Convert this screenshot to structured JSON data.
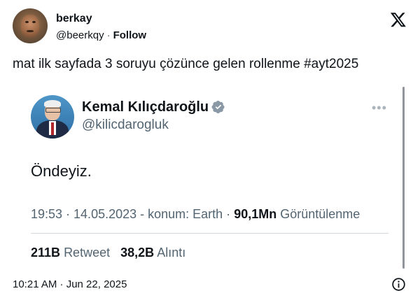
{
  "author": {
    "name": "berkay",
    "handle": "@beerkqy",
    "separator": "·",
    "follow_label": "Follow"
  },
  "brand_icon": "x-logo-icon",
  "tweet": {
    "text": "mat ilk sayfada 3 soruyu çözünce gelen rollenme #ayt2025",
    "timestamp": "10:21 AM · Jun 22, 2025",
    "info_icon": "info-icon"
  },
  "embedded_tweet": {
    "name": "Kemal Kılıçdaroğlu",
    "handle": "@kilicdarogluk",
    "verified_icon": "verified-badge-icon",
    "more_icon": "more-options-icon",
    "text": "Öndeyiz.",
    "meta_time": "19:53 · 14.05.2023 - konum: Earth ·",
    "views_count": "90,1Mn",
    "views_label": "Görüntülenme",
    "retweet_count": "211B",
    "retweet_label": "Retweet",
    "quote_count": "38,2B",
    "quote_label": "Alıntı"
  },
  "colors": {
    "text_primary": "#0f1419",
    "text_secondary": "#536471",
    "divider": "#d4d9dd",
    "background": "#ffffff"
  }
}
